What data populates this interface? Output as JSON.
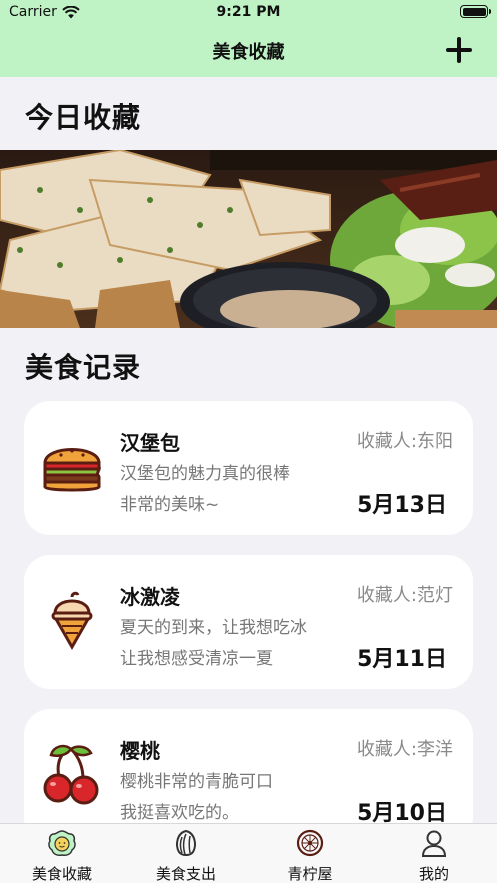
{
  "status_bar": {
    "carrier": "Carrier",
    "time": "9:21 PM"
  },
  "nav": {
    "title": "美食收藏",
    "add_icon": "plus-icon"
  },
  "today_section": {
    "title": "今日收藏"
  },
  "records_section": {
    "title": "美食记录"
  },
  "records": [
    {
      "name": "汉堡包",
      "owner": "收藏人:东阳",
      "desc_line1": "汉堡包的魅力真的很棒",
      "desc_line2": "非常的美味~",
      "date": "5月13日",
      "icon": "burger-icon"
    },
    {
      "name": "冰激凌",
      "owner": "收藏人:范灯",
      "desc_line1": "夏天的到来，让我想吃冰",
      "desc_line2": "让我想感受清凉一夏",
      "date": "5月11日",
      "icon": "ice-cream-icon"
    },
    {
      "name": "樱桃",
      "owner": "收藏人:李洋",
      "desc_line1": "樱桃非常的青脆可口",
      "desc_line2": "我挺喜欢吃的。",
      "date": "5月10日",
      "icon": "cherry-icon"
    }
  ],
  "tabs": [
    {
      "label": "美食收藏",
      "icon": "food-collection-icon",
      "active": true
    },
    {
      "label": "美食支出",
      "icon": "seed-icon",
      "active": false
    },
    {
      "label": "青柠屋",
      "icon": "lime-icon",
      "active": false
    },
    {
      "label": "我的",
      "icon": "person-icon",
      "active": false
    }
  ],
  "colors": {
    "nav_background": "#bff2c4",
    "page_background": "#f2f2f6",
    "card_background": "#ffffff"
  }
}
